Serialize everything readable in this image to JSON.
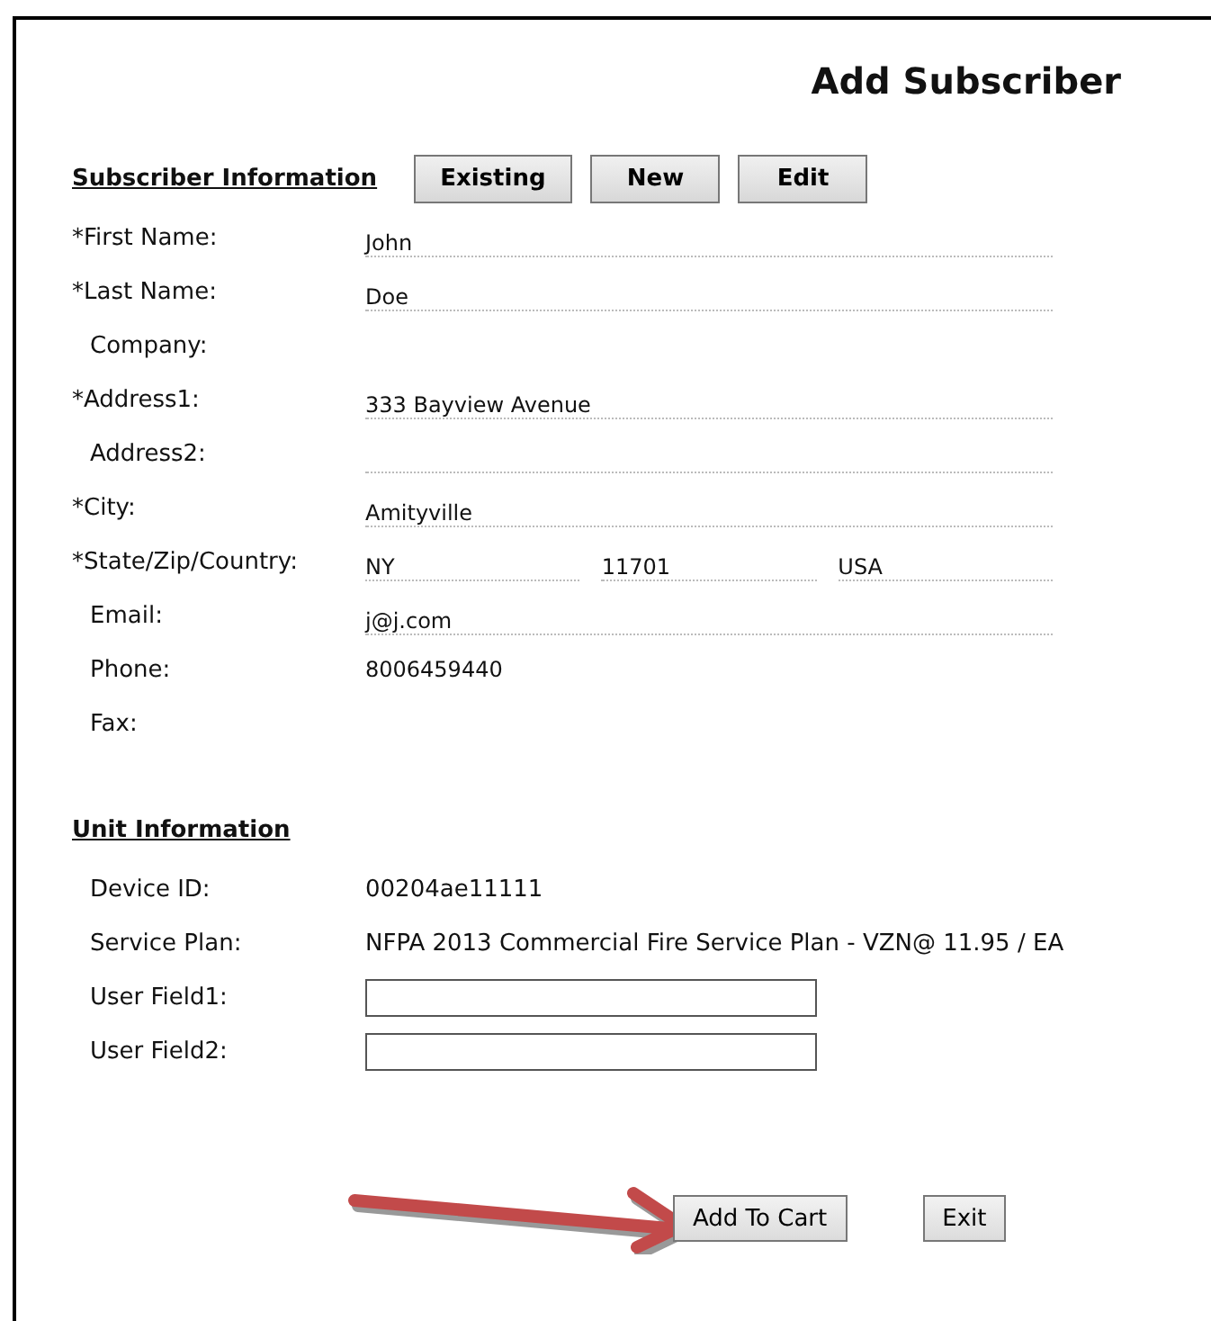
{
  "title": "Add Subscriber",
  "subscriber": {
    "heading": "Subscriber Information",
    "buttons": [
      "Existing",
      "New",
      "Edit"
    ],
    "fields": [
      {
        "label": "*First Name:",
        "required": true,
        "kind": "line",
        "values": [
          "John"
        ]
      },
      {
        "label": "*Last Name:",
        "required": true,
        "kind": "line",
        "values": [
          "Doe"
        ]
      },
      {
        "label": "Company:",
        "required": false,
        "kind": "plain"
      },
      {
        "label": "*Address1:",
        "required": true,
        "kind": "line",
        "values": [
          "333 Bayview Avenue"
        ]
      },
      {
        "label": "Address2:",
        "required": false,
        "kind": "line"
      },
      {
        "label": "*City:",
        "required": true,
        "kind": "line",
        "values": [
          "Amityville"
        ]
      },
      {
        "label": "*State/Zip/Country:",
        "required": true,
        "kind": "line",
        "values": [
          "NY",
          "11701",
          "USA"
        ]
      },
      {
        "label": "Email:",
        "required": false,
        "kind": "line",
        "values": [
          "j@j.com"
        ]
      },
      {
        "label": "Phone:",
        "required": false,
        "kind": "plain",
        "values": [
          "8006459440"
        ]
      },
      {
        "label": "Fax:",
        "required": false,
        "kind": "plain"
      }
    ]
  },
  "unit": {
    "heading": "Unit Information",
    "fields": [
      {
        "label": "Device ID:",
        "kind": "text",
        "value": "00204ae11111"
      },
      {
        "label": "Service Plan:",
        "kind": "text",
        "value": "NFPA 2013 Commercial Fire Service Plan - VZN@ 11.95 / EA"
      },
      {
        "label": "User Field1:",
        "kind": "input"
      },
      {
        "label": "User Field2:",
        "kind": "input"
      }
    ]
  },
  "actions": [
    "Add To Cart",
    "Exit"
  ]
}
